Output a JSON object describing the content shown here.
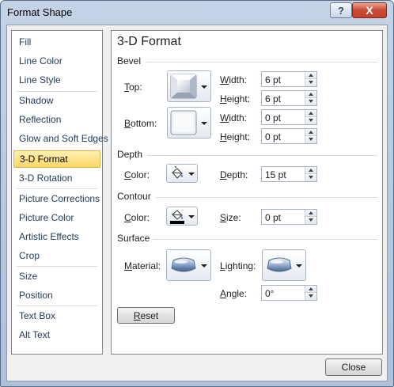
{
  "window": {
    "title": "Format Shape",
    "help_glyph": "?",
    "close_glyph": "X"
  },
  "sidebar": {
    "items": [
      {
        "label": "Fill"
      },
      {
        "label": "Line Color"
      },
      {
        "label": "Line Style"
      },
      {
        "label": "Shadow"
      },
      {
        "label": "Reflection"
      },
      {
        "label": "Glow and Soft Edges"
      },
      {
        "label": "3-D Format",
        "selected": true
      },
      {
        "label": "3-D Rotation"
      },
      {
        "label": "Picture Corrections"
      },
      {
        "label": "Picture Color"
      },
      {
        "label": "Artistic Effects"
      },
      {
        "label": "Crop"
      },
      {
        "label": "Size"
      },
      {
        "label": "Position"
      },
      {
        "label": "Text Box"
      },
      {
        "label": "Alt Text"
      }
    ]
  },
  "panel": {
    "title": "3-D Format",
    "bevel": {
      "label": "Bevel",
      "top_label_key": "T",
      "top_label_rest": "op:",
      "bottom_label_key": "B",
      "bottom_label_rest": "ottom:",
      "top_width_label_key": "W",
      "top_width_label_rest": "idth:",
      "top_width": "6 pt",
      "top_height_label_key": "H",
      "top_height_label_rest": "eight:",
      "top_height": "6 pt",
      "bottom_width_label_key": "W",
      "bottom_width_label_rest": "idth:",
      "bottom_width": "0 pt",
      "bottom_height_label_key": "H",
      "bottom_height_label_rest": "eight:",
      "bottom_height": "0 pt"
    },
    "depth": {
      "label": "Depth",
      "color_label_key": "C",
      "color_label_rest": "olor:",
      "depth_label_key": "D",
      "depth_label_rest": "epth:",
      "depth_value": "15 pt"
    },
    "contour": {
      "label": "Contour",
      "color_label_key": "C",
      "color_label_rest": "olor:",
      "size_label_key": "S",
      "size_label_rest": "ize:",
      "size_value": "0 pt"
    },
    "surface": {
      "label": "Surface",
      "material_label_key": "M",
      "material_label_rest": "aterial:",
      "lighting_label_key": "L",
      "lighting_label_rest": "ighting:",
      "angle_label_key": "A",
      "angle_label_rest": "ngle:",
      "angle_value": "0°"
    },
    "reset_key": "R",
    "reset_rest": "eset"
  },
  "footer": {
    "close_label": "Close"
  },
  "colors": {
    "selected_bg": "#ffd865",
    "label_blue": "#1e395b",
    "contour_swatch": "#000000"
  },
  "icons": [
    "bevel-top-icon",
    "bevel-bottom-icon",
    "paint-bucket-icon",
    "material-icon",
    "lighting-icon"
  ]
}
